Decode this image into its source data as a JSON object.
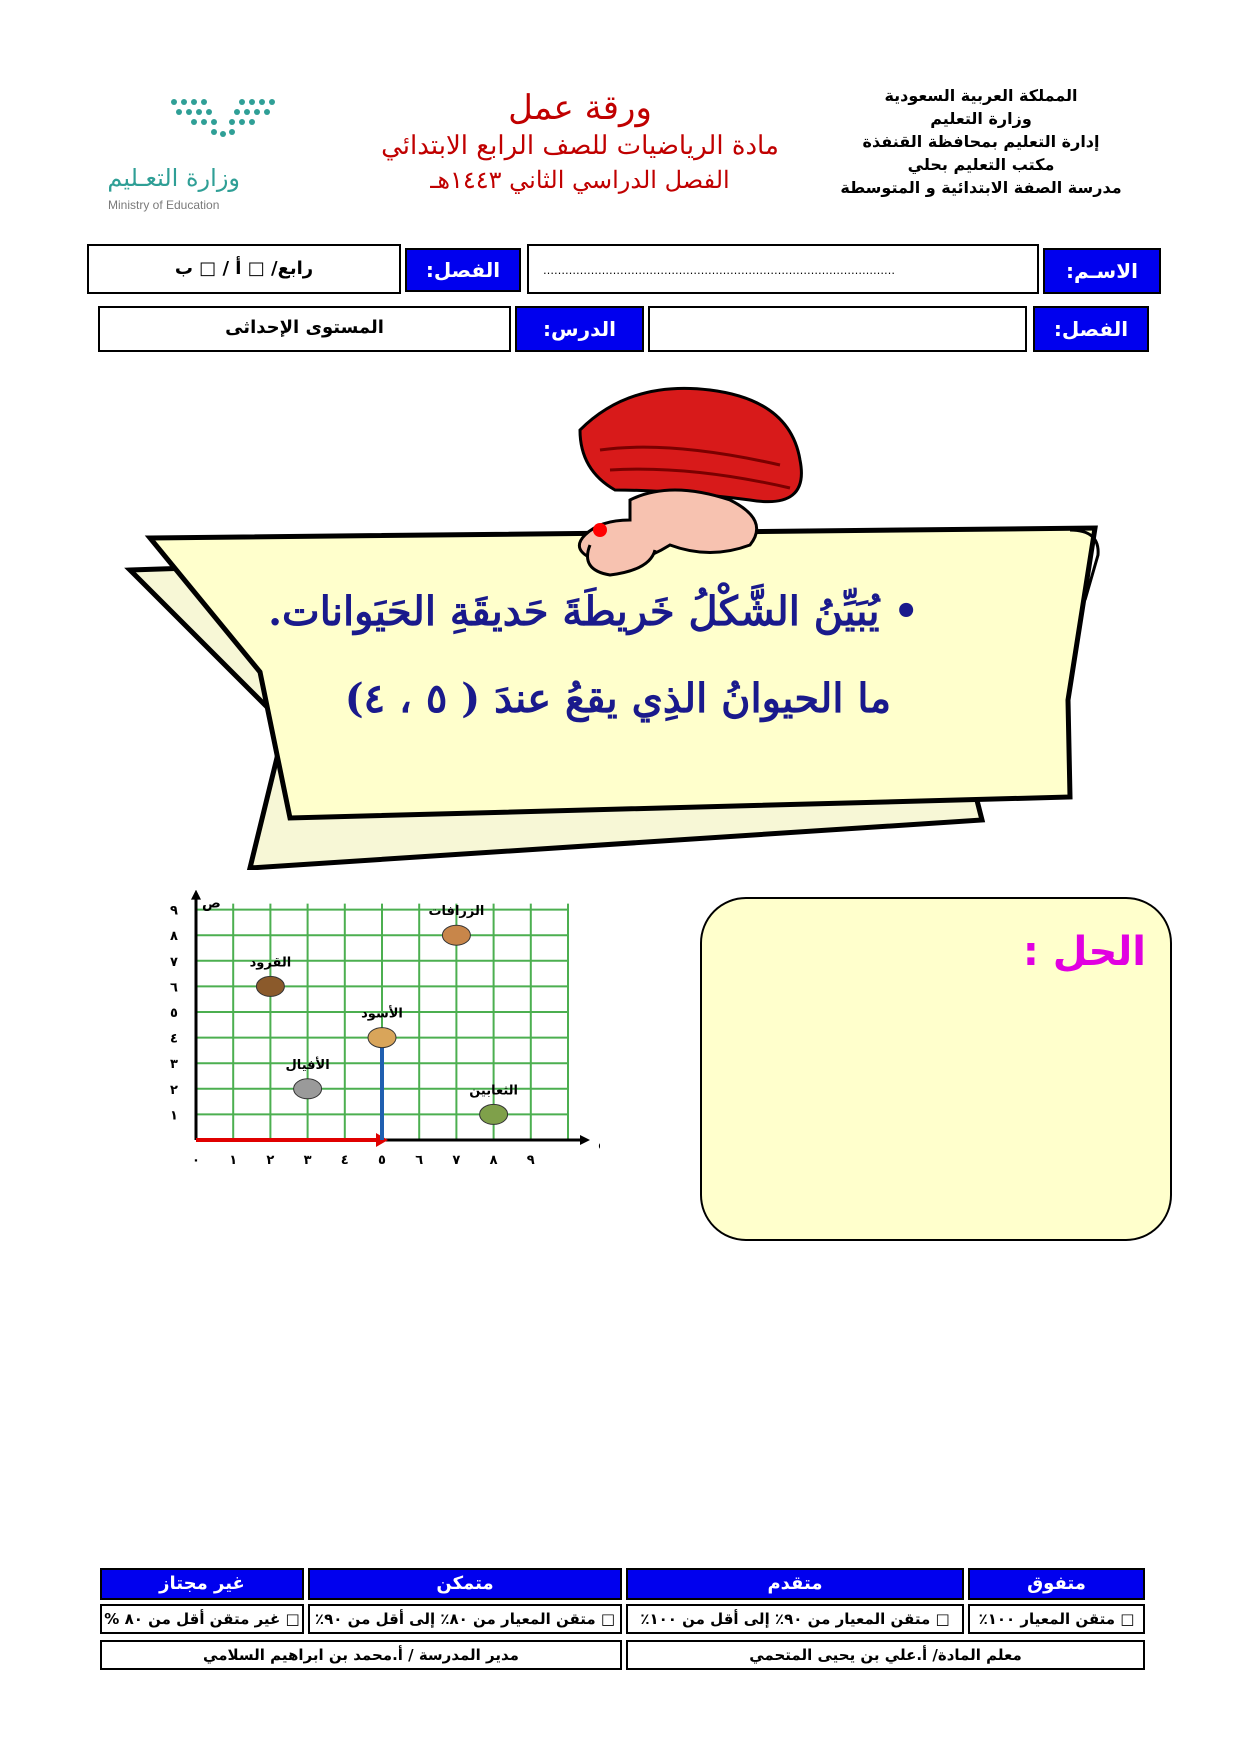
{
  "header": {
    "right_lines": [
      "المملكة العربية السعودية",
      "وزارة التعليم",
      "إدارة التعليم بمحافظة القنفذة",
      "مكتب التعليم بحلي",
      "مدرسة الصفة الابتدائية و المتوسطة"
    ],
    "title": "ورقة عمل",
    "subtitle": "مادة الرياضيات للصف الرابع الابتدائي",
    "term": "الفصل الدراسي الثاني ١٤٤٣هـ",
    "logo_ar": "وزارة التعـليم",
    "logo_en": "Ministry of Education"
  },
  "info": {
    "name_label": "الاسـم:",
    "name_dots": "……………………………………………………………………………………",
    "class_label": "الفصل:",
    "class_options": "رابع/ □ أ  /  □ ب",
    "chapter_label": "الفصل:",
    "chapter_value": "",
    "lesson_label": "الدرس:",
    "lesson_value": "المستوى الإحداثى"
  },
  "question": {
    "line1": "• يُبَيِّنُ الشَّكْلُ خَريطَةَ حَديقَةِ الحَيَوانات.",
    "line2": "ما الحيوانُ الذِي يقعُ عندَ ( ٥ ، ٤)"
  },
  "chart_data": {
    "type": "scatter",
    "x_ticks": [
      "٠",
      "١",
      "٢",
      "٣",
      "٤",
      "٥",
      "٦",
      "٧",
      "٨",
      "٩"
    ],
    "y_ticks": [
      "١",
      "٢",
      "٣",
      "٤",
      "٥",
      "٦",
      "٧",
      "٨",
      "٩"
    ],
    "xlabel": "س",
    "ylabel": "ص",
    "xlim": [
      0,
      10
    ],
    "ylim": [
      0,
      9
    ],
    "grid": true,
    "points": [
      {
        "label": "الزرافات",
        "x": 7,
        "y": 8
      },
      {
        "label": "القرود",
        "x": 2,
        "y": 6
      },
      {
        "label": "الأسود",
        "x": 5,
        "y": 4
      },
      {
        "label": "الأفيال",
        "x": 3,
        "y": 2
      },
      {
        "label": "الثعابين",
        "x": 8,
        "y": 1
      }
    ],
    "arrows": [
      {
        "from": [
          0,
          0
        ],
        "to": [
          5,
          0
        ],
        "color": "#e00000"
      },
      {
        "from": [
          5,
          0
        ],
        "to": [
          5,
          4
        ],
        "color": "#1f5fb0"
      }
    ]
  },
  "solution": {
    "label": "الحل :"
  },
  "rubric": {
    "levels": [
      "متفوق",
      "متقدم",
      "متمكن",
      "غير مجتاز"
    ],
    "criteria": [
      "□ متقن المعيار ١٠٠٪",
      "□ متقن المعيار من ٩٠٪  إلى أقل من ١٠٠٪",
      "□ متقن المعيار من ٨٠٪ إلى أقل من ٩٠٪",
      "□ غير متقن أقل من ٨٠ %"
    ],
    "teacher": "معلم المادة/ أ.علي بن يحيى المتحمي",
    "principal": "مدير المدرسة / أ.محمد بن ابراهيم السلامي"
  },
  "colors": {
    "blue": "#0000ee",
    "title_red": "#c00000",
    "solution_bg": "#ffffcc",
    "solution_label": "#e100e1"
  }
}
